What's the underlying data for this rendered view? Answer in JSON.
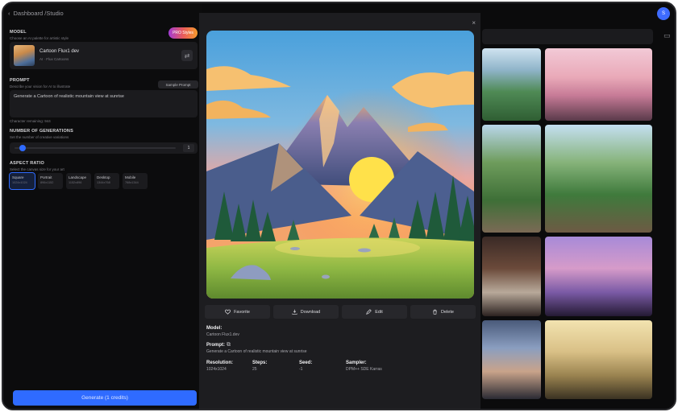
{
  "app": {
    "back_label": "Dashboard /Studio"
  },
  "model": {
    "title": "MODEL",
    "subtitle": "Choose an AI palette for artistic style",
    "badge": "PRO Styles",
    "name": "Cartoon Flux1 dev",
    "meta": "AI · Flux Cartoons"
  },
  "prompt": {
    "title": "PROMPT",
    "subtitle": "Describe your vision for AI to illustrate",
    "sample_button": "Sample Prompt",
    "value": "Generate a Cartoon of realistic mountain view at sunrise",
    "remaining": "Character remaining: 944"
  },
  "generations": {
    "title": "NUMBER OF GENERATIONS",
    "subtitle": "Set the number of creative variations",
    "value": "1",
    "level": 0.05
  },
  "aspect": {
    "title": "ASPECT RATIO",
    "subtitle": "Select the canvas size for your art",
    "options": [
      {
        "label": "Square",
        "dim": "1024x1024"
      },
      {
        "label": "Portrait",
        "dim": "896x1152"
      },
      {
        "label": "Landscape",
        "dim": "1152x896"
      },
      {
        "label": "Desktop",
        "dim": "1344x768"
      },
      {
        "label": "Mobile",
        "dim": "768x1344"
      }
    ]
  },
  "generate_button": "Generate (1 credits)",
  "user_initial": "S",
  "modal": {
    "close": "×",
    "actions": {
      "favorite": "Favorite",
      "download": "Download",
      "edit": "Edit",
      "delete": "Delete"
    },
    "model_label": "Model:",
    "model_value": "Cartoon Flux1.dev",
    "prompt_label": "Prompt:",
    "prompt_value": "Generate a Cartoon of realistic mountain view at sunrise",
    "resolution_label": "Resolution:",
    "resolution_value": "1024x1024",
    "steps_label": "Steps:",
    "steps_value": "25",
    "seed_label": "Seed:",
    "seed_value": "-1",
    "sampler_label": "Sampler:",
    "sampler_value": "DPM++ SDE Karras"
  },
  "colors": {
    "accent": "#2f6bff",
    "surface": "#1d1d20",
    "background": "#0b0b0c"
  }
}
